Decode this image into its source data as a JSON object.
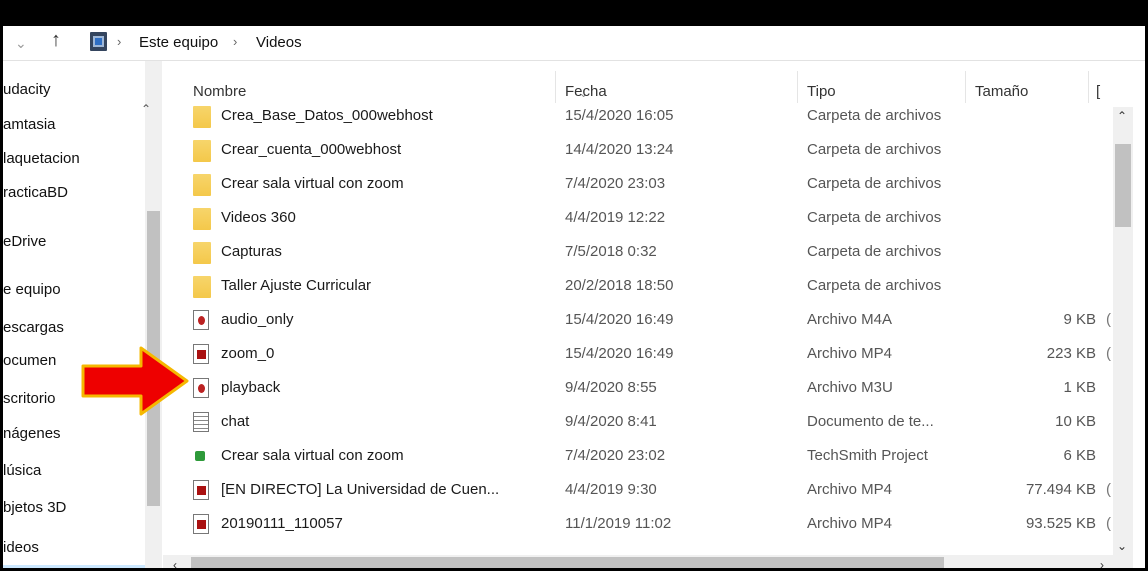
{
  "address": {
    "breadcrumb": [
      "Este equipo",
      "Videos"
    ]
  },
  "nav": {
    "items": [
      {
        "label": "udacity"
      },
      {
        "label": "amtasia"
      },
      {
        "label": "laquetacion"
      },
      {
        "label": "racticaBD"
      },
      {
        "label": "eDrive"
      },
      {
        "label": "e equipo"
      },
      {
        "label": "escargas"
      },
      {
        "label": "ocumen"
      },
      {
        "label": "scritorio"
      },
      {
        "label": "nágenes"
      },
      {
        "label": "lúsica"
      },
      {
        "label": "bjetos 3D"
      },
      {
        "label": "ideos"
      }
    ]
  },
  "columns": {
    "name": "Nombre",
    "date": "Fecha",
    "type": "Tipo",
    "size": "Tamaño",
    "extra": "["
  },
  "files": [
    {
      "icon": "folder-icon",
      "name": "Crea_Base_Datos_000webhost",
      "date": "15/4/2020 16:05",
      "type": "Carpeta de archivos",
      "size": "",
      "extra": ""
    },
    {
      "icon": "folder-icon",
      "name": "Crear_cuenta_000webhost",
      "date": "14/4/2020 13:24",
      "type": "Carpeta de archivos",
      "size": "",
      "extra": ""
    },
    {
      "icon": "folder-icon",
      "name": "Crear sala virtual con zoom",
      "date": "7/4/2020 23:03",
      "type": "Carpeta de archivos",
      "size": "",
      "extra": ""
    },
    {
      "icon": "folder-icon",
      "name": "Videos 360",
      "date": "4/4/2019 12:22",
      "type": "Carpeta de archivos",
      "size": "",
      "extra": ""
    },
    {
      "icon": "folder-icon",
      "name": "Capturas",
      "date": "7/5/2018 0:32",
      "type": "Carpeta de archivos",
      "size": "",
      "extra": ""
    },
    {
      "icon": "folder-icon",
      "name": "Taller Ajuste Curricular",
      "date": "20/2/2018 18:50",
      "type": "Carpeta de archivos",
      "size": "",
      "extra": ""
    },
    {
      "icon": "media-file-icon",
      "name": "audio_only",
      "date": "15/4/2020 16:49",
      "type": "Archivo M4A",
      "size": "9 KB",
      "extra": "("
    },
    {
      "icon": "video-file-icon",
      "name": "zoom_0",
      "date": "15/4/2020 16:49",
      "type": "Archivo MP4",
      "size": "223 KB",
      "extra": "("
    },
    {
      "icon": "media-file-icon",
      "name": "playback",
      "date": "9/4/2020 8:55",
      "type": "Archivo M3U",
      "size": "1 KB",
      "extra": ""
    },
    {
      "icon": "text-file-icon",
      "name": "chat",
      "date": "9/4/2020 8:41",
      "type": "Documento de te...",
      "size": "10 KB",
      "extra": ""
    },
    {
      "icon": "techsmith-project-icon",
      "name": "Crear sala virtual con zoom",
      "date": "7/4/2020 23:02",
      "type": "TechSmith Project",
      "size": "6 KB",
      "extra": ""
    },
    {
      "icon": "video-file-icon",
      "name": "[EN DIRECTO] La Universidad de Cuen...",
      "date": "4/4/2019 9:30",
      "type": "Archivo MP4",
      "size": "77.494 KB",
      "extra": "("
    },
    {
      "icon": "video-file-icon",
      "name": "20190111_110057",
      "date": "11/1/2019 11:02",
      "type": "Archivo MP4",
      "size": "93.525 KB",
      "extra": "("
    }
  ],
  "colors": {
    "selection": "#cce8ff",
    "folder": "#f4c84a",
    "arrow_fill": "#ee0000",
    "arrow_outline": "#f5b800"
  }
}
